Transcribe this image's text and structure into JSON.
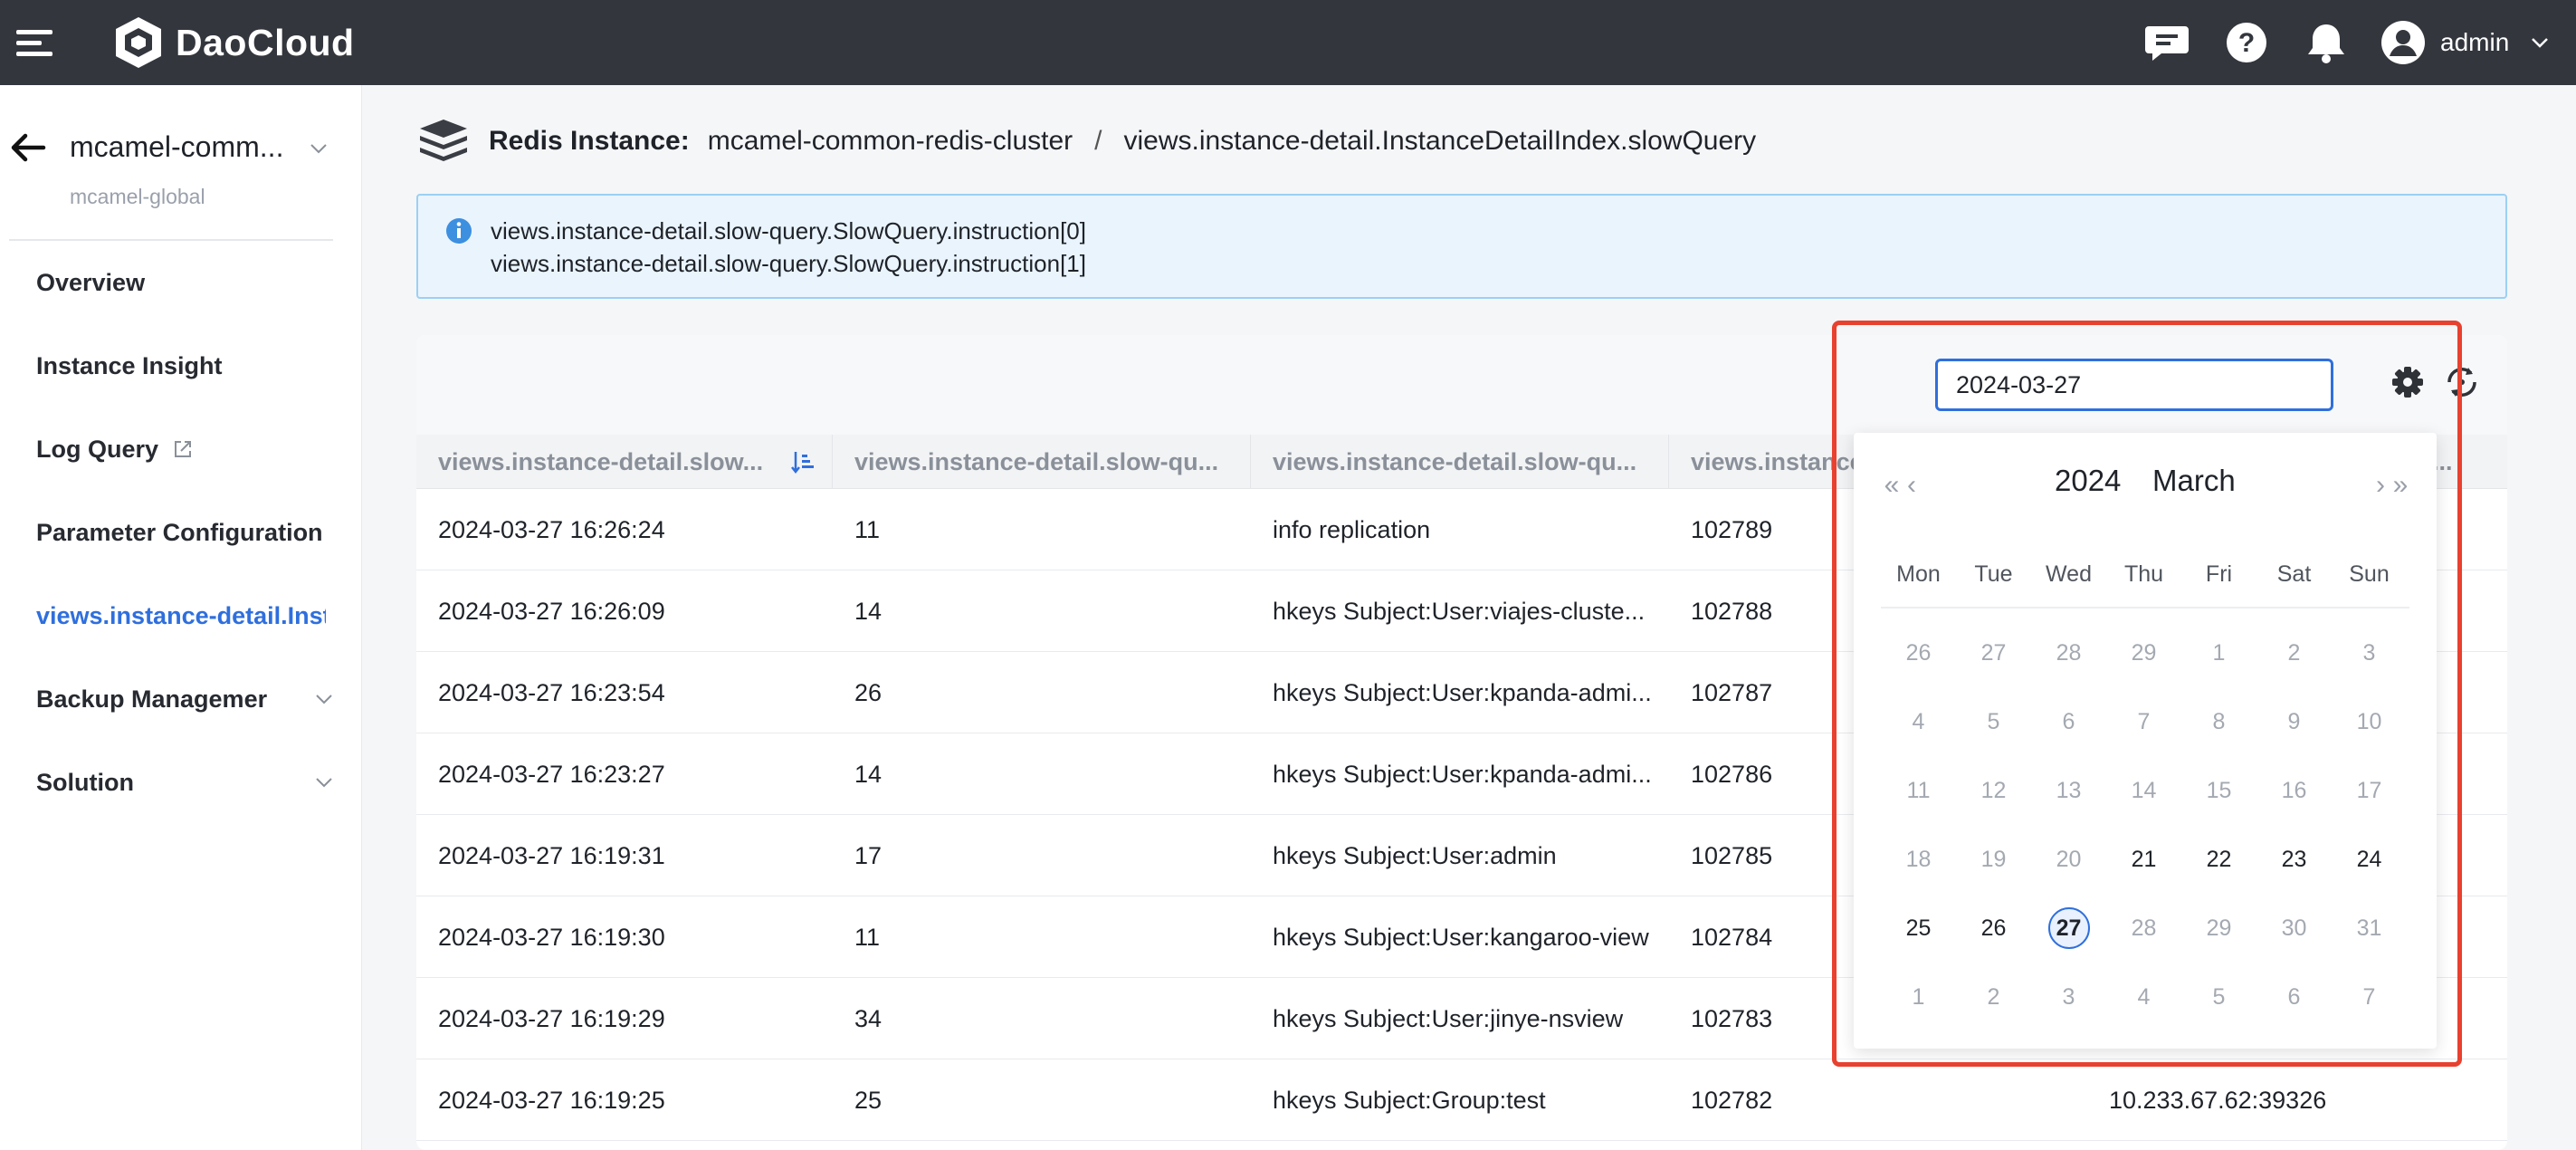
{
  "topbar": {
    "brand": "DaoCloud",
    "username": "admin",
    "icons": [
      "menu-icon",
      "message-icon",
      "help-icon",
      "bell-icon",
      "user-avatar-icon",
      "chevron-down-icon"
    ]
  },
  "sidebar": {
    "instance_name": "mcamel-comm...",
    "instance_subtitle": "mcamel-global",
    "items": [
      {
        "label": "Overview"
      },
      {
        "label": "Instance Insight"
      },
      {
        "label": "Log Query"
      },
      {
        "label": "Parameter Configuration"
      },
      {
        "label": "views.instance-detail.InstanceDetailIndex.slowQuery"
      },
      {
        "label": "Backup Managemer"
      },
      {
        "label": "Solution"
      }
    ]
  },
  "breadcrumb": {
    "label": "Redis Instance:",
    "instance": "mcamel-common-redis-cluster",
    "separator": "/",
    "page": "views.instance-detail.InstanceDetailIndex.slowQuery"
  },
  "info": {
    "line1": "views.instance-detail.slow-query.SlowQuery.instruction[0]",
    "line2": "views.instance-detail.slow-query.SlowQuery.instruction[1]"
  },
  "toolbar": {
    "date_value": "2024-03-27"
  },
  "table": {
    "headers": [
      "views.instance-detail.slow...",
      "views.instance-detail.slow-qu...",
      "views.instance-detail.slow-qu...",
      "views.instance",
      "",
      "qu..."
    ],
    "rows": [
      {
        "time": "2024-03-27 16:26:24",
        "duration": "11",
        "command": "info replication",
        "id": "102789",
        "client": ""
      },
      {
        "time": "2024-03-27 16:26:09",
        "duration": "14",
        "command": "hkeys Subject:User:viajes-cluste...",
        "id": "102788",
        "client": ""
      },
      {
        "time": "2024-03-27 16:23:54",
        "duration": "26",
        "command": "hkeys Subject:User:kpanda-admi...",
        "id": "102787",
        "client": ""
      },
      {
        "time": "2024-03-27 16:23:27",
        "duration": "14",
        "command": "hkeys Subject:User:kpanda-admi...",
        "id": "102786",
        "client": ""
      },
      {
        "time": "2024-03-27 16:19:31",
        "duration": "17",
        "command": "hkeys Subject:User:admin",
        "id": "102785",
        "client": ""
      },
      {
        "time": "2024-03-27 16:19:30",
        "duration": "11",
        "command": "hkeys Subject:User:kangaroo-view",
        "id": "102784",
        "client": ""
      },
      {
        "time": "2024-03-27 16:19:29",
        "duration": "34",
        "command": "hkeys Subject:User:jinye-nsview",
        "id": "102783",
        "client": ""
      },
      {
        "time": "2024-03-27 16:19:25",
        "duration": "25",
        "command": "hkeys Subject:Group:test",
        "id": "102782",
        "client": "10.233.67.62:39326"
      }
    ]
  },
  "calendar": {
    "year": "2024",
    "month": "March",
    "prev_year": "«",
    "prev_month": "‹",
    "next_month": "›",
    "next_year": "»",
    "weekdays": [
      "Mon",
      "Tue",
      "Wed",
      "Thu",
      "Fri",
      "Sat",
      "Sun"
    ],
    "weeks": [
      [
        {
          "d": "26",
          "s": "other"
        },
        {
          "d": "27",
          "s": "other"
        },
        {
          "d": "28",
          "s": "other"
        },
        {
          "d": "29",
          "s": "other"
        },
        {
          "d": "1",
          "s": "disabled"
        },
        {
          "d": "2",
          "s": "disabled"
        },
        {
          "d": "3",
          "s": "disabled"
        }
      ],
      [
        {
          "d": "4",
          "s": "disabled"
        },
        {
          "d": "5",
          "s": "disabled"
        },
        {
          "d": "6",
          "s": "disabled"
        },
        {
          "d": "7",
          "s": "disabled"
        },
        {
          "d": "8",
          "s": "disabled"
        },
        {
          "d": "9",
          "s": "disabled"
        },
        {
          "d": "10",
          "s": "disabled"
        }
      ],
      [
        {
          "d": "11",
          "s": "disabled"
        },
        {
          "d": "12",
          "s": "disabled"
        },
        {
          "d": "13",
          "s": "disabled"
        },
        {
          "d": "14",
          "s": "disabled"
        },
        {
          "d": "15",
          "s": "disabled"
        },
        {
          "d": "16",
          "s": "disabled"
        },
        {
          "d": "17",
          "s": "disabled"
        }
      ],
      [
        {
          "d": "18",
          "s": "disabled"
        },
        {
          "d": "19",
          "s": "disabled"
        },
        {
          "d": "20",
          "s": "disabled"
        },
        {
          "d": "21",
          "s": "cur"
        },
        {
          "d": "22",
          "s": "cur"
        },
        {
          "d": "23",
          "s": "cur"
        },
        {
          "d": "24",
          "s": "cur"
        }
      ],
      [
        {
          "d": "25",
          "s": "cur"
        },
        {
          "d": "26",
          "s": "cur"
        },
        {
          "d": "27",
          "s": "selected"
        },
        {
          "d": "28",
          "s": "disabled"
        },
        {
          "d": "29",
          "s": "disabled"
        },
        {
          "d": "30",
          "s": "disabled"
        },
        {
          "d": "31",
          "s": "disabled"
        }
      ],
      [
        {
          "d": "1",
          "s": "other"
        },
        {
          "d": "2",
          "s": "other"
        },
        {
          "d": "3",
          "s": "other"
        },
        {
          "d": "4",
          "s": "other"
        },
        {
          "d": "5",
          "s": "other"
        },
        {
          "d": "6",
          "s": "other"
        },
        {
          "d": "7",
          "s": "other"
        }
      ]
    ]
  },
  "colors": {
    "topbar": "#33363d",
    "accent": "#2f6fdd",
    "info_bg": "#eaf4fd",
    "highlight": "#e8412f"
  }
}
